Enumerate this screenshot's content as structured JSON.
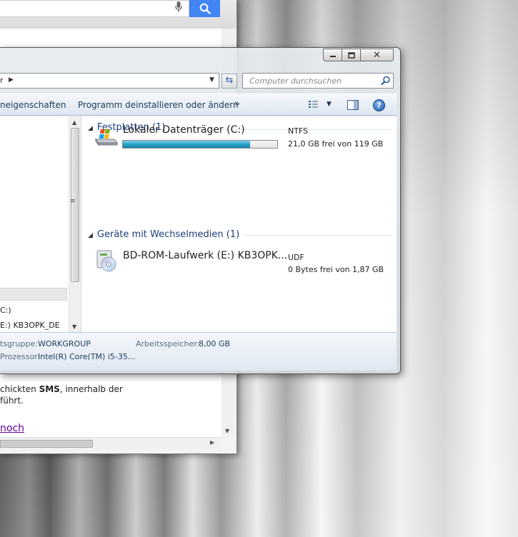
{
  "browser": {
    "snippet_line1_pre": "chickten ",
    "snippet_line1_bold": "SMS",
    "snippet_line1_post": ", innerhalb der",
    "snippet_line2": "führt.",
    "link_text": "noch"
  },
  "explorer": {
    "search_placeholder": "Computer durchsuchen",
    "toolbar": {
      "item_properties": "neigenschaften",
      "item_uninstall": "Programm deinstallieren oder ändern",
      "more": "»"
    },
    "navpane": {
      "item_c": "C:)",
      "item_e": "E:) KB3OPK_DE"
    },
    "groups": [
      {
        "title": "Festplatten (1)",
        "drives": [
          {
            "name": "Lokaler Datenträger (C:)",
            "filesystem": "NTFS",
            "free_text": "21,0 GB frei von 119 GB",
            "used_fraction": 0.823,
            "icon": "hard-drive-windows-icon"
          }
        ]
      },
      {
        "title": "Geräte mit Wechselmedien (1)",
        "drives": [
          {
            "name": "BD-ROM-Laufwerk (E:) KB3OPK...",
            "filesystem": "UDF",
            "free_text": "0 Bytes frei von 1,87 GB",
            "icon": "optical-disc-drive-icon"
          }
        ]
      }
    ],
    "details": {
      "workgroup_label": "tsgruppe:",
      "workgroup_value": "WORKGROUP",
      "memory_label": "Arbeitsspeicher:",
      "memory_value": "8,00 GB",
      "processor_label": "Prozessor:",
      "processor_value": "Intel(R) Core(TM) i5-35..."
    }
  }
}
